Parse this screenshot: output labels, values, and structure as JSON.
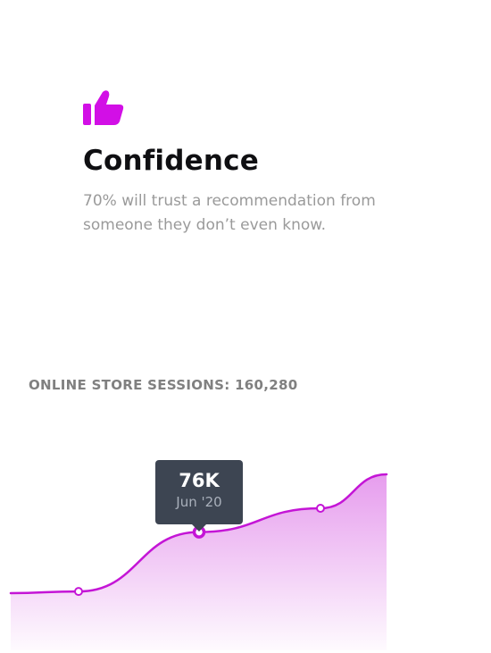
{
  "feature": {
    "icon": "thumbs-up-icon",
    "accent_color": "#d20fe6",
    "title": "Confidence",
    "description": "70% will trust a recommendation from someone they don’t even know."
  },
  "stats": {
    "label": "ONLINE STORE SESSIONS: 160,280"
  },
  "tooltip": {
    "value": "76K",
    "date": "Jun '20"
  },
  "chart_data": {
    "type": "area",
    "color": "#c415d6",
    "x": [
      "",
      "",
      "Jun '20",
      "",
      ""
    ],
    "values": [
      40,
      41,
      76,
      90,
      110
    ],
    "highlight_index": 2,
    "marked_points": [
      1,
      2,
      3
    ],
    "ylim": [
      0,
      140
    ],
    "grid": false
  }
}
